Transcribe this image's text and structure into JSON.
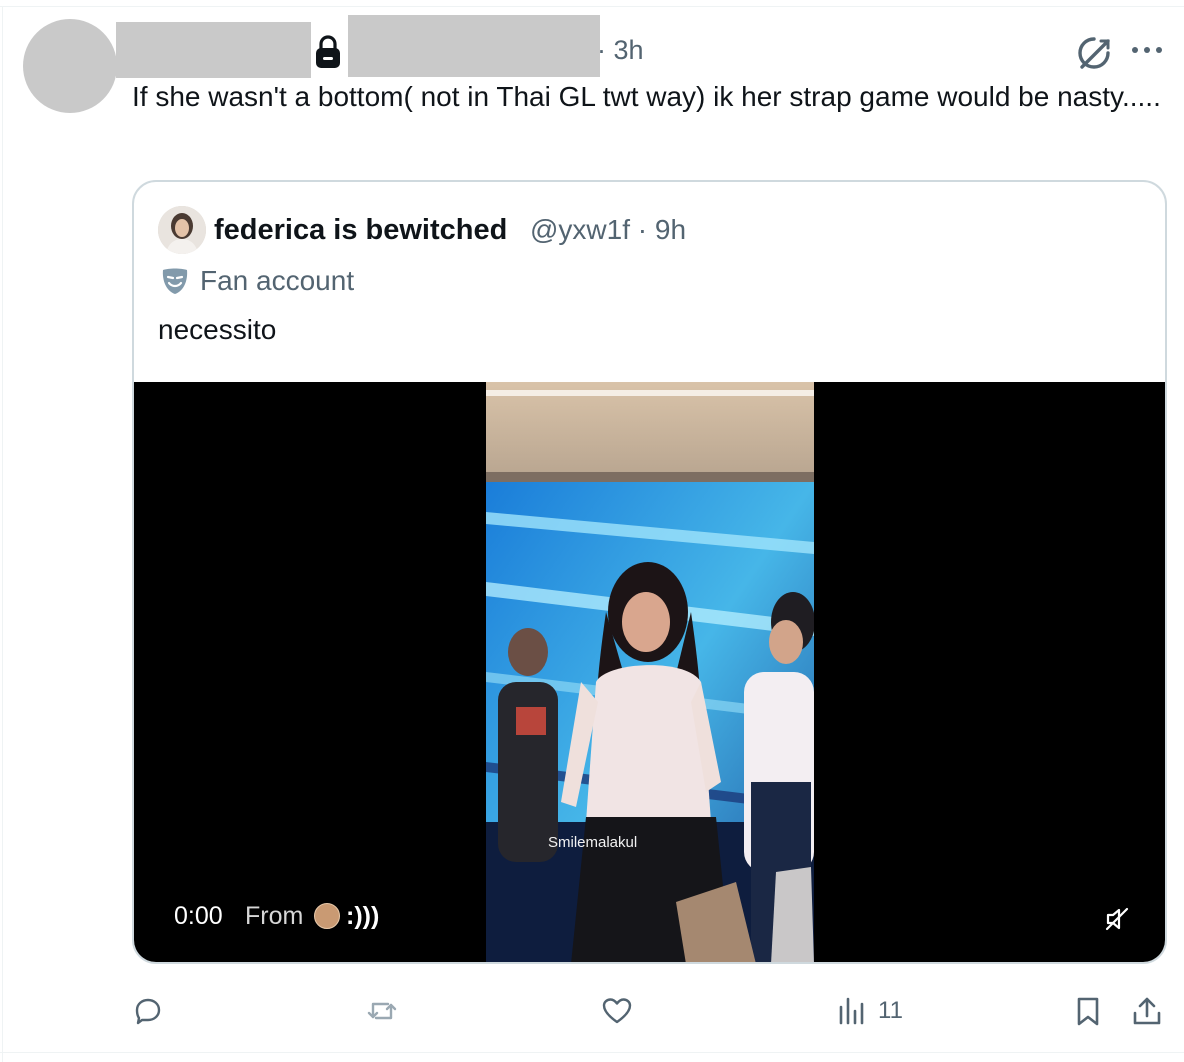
{
  "post": {
    "time": "· 3h",
    "text": "If she wasn't a bottom( not in Thai GL twt way) ik her strap game would be nasty....."
  },
  "icons": {
    "lock": "lock-icon",
    "grok": "grok-icon",
    "more": "more-icon"
  },
  "quote": {
    "display_name": "federica is bewitched",
    "handle": "@yxw1f",
    "time": "9h",
    "badge_label": "Fan account",
    "text": "necessito",
    "video": {
      "watermark": "Smilemalakul",
      "timecode": "0:00",
      "from_label": "From",
      "from_name": ":)))"
    }
  },
  "actions": {
    "reply_count": "",
    "repost_count": "",
    "like_count": "",
    "views_count": "11"
  },
  "colors": {
    "text": "#0f1419",
    "muted": "#536471",
    "border": "#cfd9de",
    "redaction": "#c9c9c9"
  }
}
